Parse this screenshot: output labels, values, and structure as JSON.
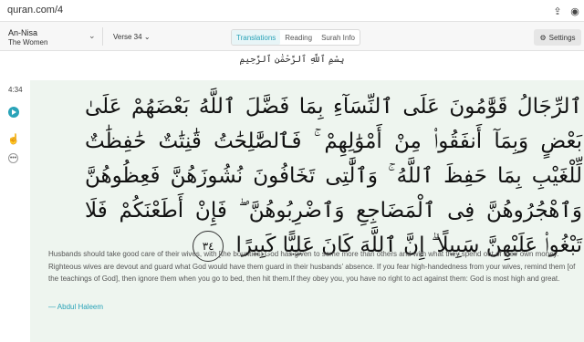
{
  "browser": {
    "url": "quran.com/4"
  },
  "header": {
    "surah_name": "An-Nisa",
    "surah_english": "The Women",
    "verse_label": "Verse 34",
    "tabs": [
      {
        "label": "Translations",
        "active": true
      },
      {
        "label": "Reading",
        "active": false
      },
      {
        "label": "Surah Info",
        "active": false
      }
    ],
    "settings_label": "Settings"
  },
  "bismillah": "بِسْمِ ٱللَّهِ ٱلرَّحْمَٰنِ ٱلرَّحِيمِ",
  "verse": {
    "timestamp": "4:34",
    "arabic": "ٱلرِّجَالُ قَوَّٰمُونَ عَلَى ٱلنِّسَآءِ بِمَا فَضَّلَ ٱللَّهُ بَعْضَهُمْ عَلَىٰ بَعْضٍ وَبِمَآ أَنفَقُوا۟ مِنْ أَمْوَٰلِهِمْ ۚ فَٱلصَّٰلِحَٰتُ قَٰنِتَٰتٌ حَٰفِظَٰتٌ لِّلْغَيْبِ بِمَا حَفِظَ ٱللَّهُ ۚ وَٱلَّٰتِى تَخَافُونَ نُشُوزَهُنَّ فَعِظُوهُنَّ وَٱهْجُرُوهُنَّ فِى ٱلْمَضَاجِعِ وَٱضْرِبُوهُنَّ ۖ فَإِنْ أَطَعْنَكُمْ فَلَا تَبْغُوا۟ عَلَيْهِنَّ سَبِيلًا ۗ إِنَّ ٱللَّهَ كَانَ عَلِيًّا كَبِيرًا",
    "ayah_number": "٣٤",
    "translation": "Husbands should take good care of their wives, with [the bounties] God has given to some more than others and with what they spend out of their own money. Righteous wives are devout and guard what God would have them guard in their husbands’ absence. If you fear high-handedness from your wives, remind them [of the teachings of God], then ignore them when you go to bed, then hit them.If they obey you, you have no right to act against them: God is most high and great.",
    "translator": "— Abdul Haleem"
  },
  "colors": {
    "accent": "#2aa3b8",
    "verse_bg": "#eef5ef"
  }
}
